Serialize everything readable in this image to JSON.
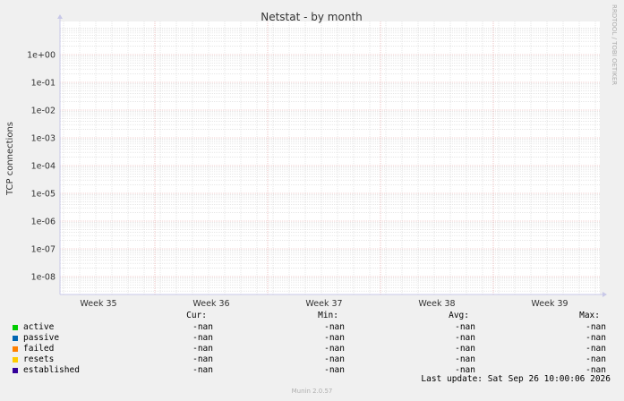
{
  "chart_data": {
    "type": "line",
    "title": "Netstat - by month",
    "ylabel": "TCP connections",
    "xlabel": "",
    "y_scale": "log",
    "y_ticks": [
      "1e+00",
      "1e-01",
      "1e-02",
      "1e-03",
      "1e-04",
      "1e-05",
      "1e-06",
      "1e-07",
      "1e-08"
    ],
    "x_ticks": [
      "Week 35",
      "Week 36",
      "Week 37",
      "Week 38",
      "Week 39"
    ],
    "grid": true,
    "watermark": "RRDTOOL / TOBI OETIKER",
    "series": [
      {
        "name": "active",
        "color": "#00cc00",
        "values": []
      },
      {
        "name": "passive",
        "color": "#0066b3",
        "values": []
      },
      {
        "name": "failed",
        "color": "#ff8000",
        "values": []
      },
      {
        "name": "resets",
        "color": "#ffcc00",
        "values": []
      },
      {
        "name": "established",
        "color": "#330099",
        "values": []
      }
    ]
  },
  "legend": {
    "headers": {
      "cur": "Cur:",
      "min": "Min:",
      "avg": "Avg:",
      "max": "Max:"
    },
    "rows": [
      {
        "name": "active",
        "color": "#00cc00",
        "cur": "-nan",
        "min": "-nan",
        "avg": "-nan",
        "max": "-nan"
      },
      {
        "name": "passive",
        "color": "#0066b3",
        "cur": "-nan",
        "min": "-nan",
        "avg": "-nan",
        "max": "-nan"
      },
      {
        "name": "failed",
        "color": "#ff8000",
        "cur": "-nan",
        "min": "-nan",
        "avg": "-nan",
        "max": "-nan"
      },
      {
        "name": "resets",
        "color": "#ffcc00",
        "cur": "-nan",
        "min": "-nan",
        "avg": "-nan",
        "max": "-nan"
      },
      {
        "name": "established",
        "color": "#330099",
        "cur": "-nan",
        "min": "-nan",
        "avg": "-nan",
        "max": "-nan"
      }
    ]
  },
  "last_update": "Last update: Sat Sep 26 10:00:06 2026",
  "footer": "Munin 2.0.57"
}
